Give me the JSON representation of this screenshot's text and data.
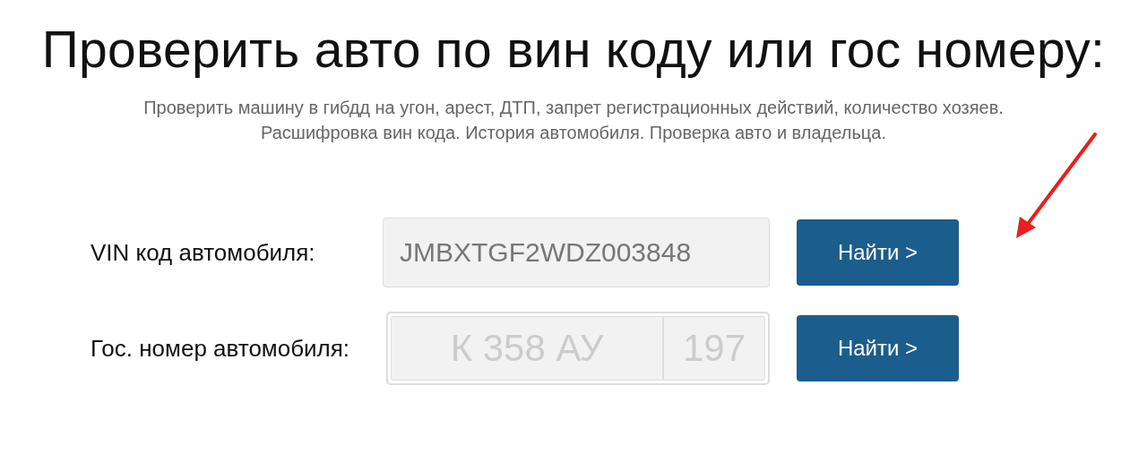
{
  "title": "Проверить авто по вин коду или гос номеру:",
  "subtitle": "Проверить машину в гибдд на угон, арест, ДТП, запрет регистрационных действий, количество хозяев. Расшифровка вин кода. История автомобиля. Проверка авто и владельца.",
  "rows": [
    {
      "kind": "vin",
      "label": "VIN код автомобиля:",
      "placeholder": "JMBXTGF2WDZ003848",
      "button": "Найти >"
    },
    {
      "kind": "plate",
      "label": "Гос. номер автомобиля:",
      "placeholder": "К 358 АУ",
      "region_placeholder": "197",
      "button": "Найти >"
    }
  ]
}
